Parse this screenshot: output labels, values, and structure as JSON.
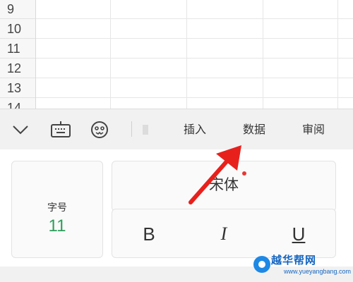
{
  "grid": {
    "row_numbers": [
      "9",
      "10",
      "11",
      "12",
      "13",
      "14"
    ]
  },
  "toolbar": {
    "icons": [
      "collapse-chevron-icon",
      "keyboard-icon",
      "emoji-icon",
      "faded-tab-icon"
    ],
    "tabs": [
      "插入",
      "数据",
      "审阅"
    ]
  },
  "format_panel": {
    "font_size_label": "字号",
    "font_size_value": "11",
    "font_name": "宋体",
    "bold": "B",
    "italic": "I",
    "underline": "U"
  },
  "annotation": {
    "arrow_color": "#e8201c"
  },
  "watermark": {
    "name": "越华帮网",
    "url": "www.yueyangbang.com"
  },
  "colors": {
    "accent_green": "#2e9e5b",
    "notification_dot": "#e53935"
  }
}
